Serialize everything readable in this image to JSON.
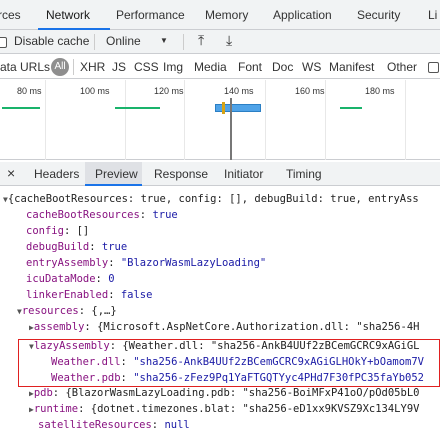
{
  "tabs": [
    "rces",
    "Network",
    "Performance",
    "Memory",
    "Application",
    "Security",
    "Li"
  ],
  "active_tab": "Network",
  "toolbar": {
    "disable_cache": "Disable cache",
    "throttle": "Online",
    "throttle_arrow": "▼",
    "upload_icon": "⤒",
    "download_icon": "⤓"
  },
  "filters": {
    "data_urls": "ata URLs",
    "all": "All",
    "types": [
      "XHR",
      "JS",
      "CSS",
      "Img",
      "Media",
      "Font",
      "Doc",
      "WS",
      "Manifest",
      "Other"
    ]
  },
  "timeline": {
    "ticks": [
      "80 ms",
      "100 ms",
      "120 ms",
      "140 ms",
      "160 ms",
      "180 ms"
    ]
  },
  "detail_tabs": [
    "Headers",
    "Preview",
    "Response",
    "Initiator",
    "Timing"
  ],
  "active_detail_tab": "Preview",
  "close_icon": "×",
  "preview": {
    "line0": "{cacheBootResources: true, config: [], debugBuild: true, entryAss",
    "cacheBootResources_k": "cacheBootResources",
    "cacheBootResources_v": "true",
    "config_k": "config",
    "config_v": "[]",
    "debugBuild_k": "debugBuild",
    "debugBuild_v": "true",
    "entryAssembly_k": "entryAssembly",
    "entryAssembly_v": "\"BlazorWasmLazyLoading\"",
    "icuDataMode_k": "icuDataMode",
    "icuDataMode_v": "0",
    "linkerEnabled_k": "linkerEnabled",
    "linkerEnabled_v": "false",
    "resources_k": "resources",
    "resources_v": "{,…}",
    "assembly_k": "assembly",
    "assembly_v": "{Microsoft.AspNetCore.Authorization.dll: \"sha256-4H",
    "lazyAssembly_k": "lazyAssembly",
    "lazyAssembly_v": "{Weather.dll: \"sha256-AnkB4UUf2zBCemGCRC9xAGiGL",
    "weatherDll_k": "Weather.dll",
    "weatherDll_v": "\"sha256-AnkB4UUf2zBCemGCRC9xAGiGLHOkY+bOamom7V",
    "weatherPdb_k": "Weather.pdb",
    "weatherPdb_v": "\"sha256-zFez9Pq1YaFTGQTYyc4PHd7F30fPC35faYb052",
    "pdb_k": "pdb",
    "pdb_v": "{BlazorWasmLazyLoading.pdb: \"sha256-BoiMFxP41oO/pOd05bL0",
    "runtime_k": "runtime",
    "runtime_v": "{dotnet.timezones.blat: \"sha256-eD1xx9KVSZ9Xc134LY9V",
    "satelliteResources_k": "satelliteResources",
    "satelliteResources_v": "null"
  },
  "colors": {
    "accent": "#1a73e8",
    "highlight": "#e02020",
    "key": "#881280",
    "string": "#1a1aa6"
  }
}
